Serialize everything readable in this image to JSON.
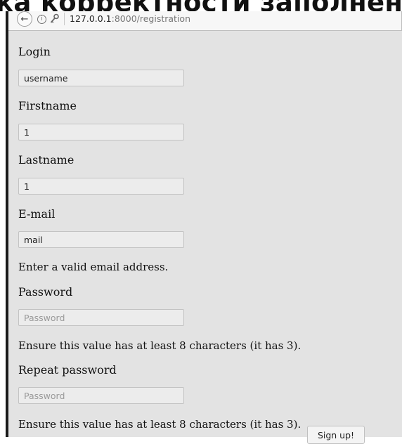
{
  "banner_text": "ка корректности заполнени",
  "browser": {
    "url_host": "127.0.0.1",
    "url_path": ":8000/registration",
    "back_icon": "arrow-left-icon",
    "info_icon": "info-icon",
    "key_icon": "key-icon"
  },
  "form": {
    "login_label": "Login",
    "login_value": "username",
    "firstname_label": "Firstname",
    "firstname_value": "1",
    "lastname_label": "Lastname",
    "lastname_value": "1",
    "email_label": "E-mail",
    "email_value": "mail",
    "email_error": "Enter a valid email address.",
    "password_label": "Password",
    "password_placeholder": "Password",
    "password_error": "Ensure this value has at least 8 characters (it has 3).",
    "repeat_label": "Repeat password",
    "repeat_placeholder": "Password",
    "repeat_error": "Ensure this value has at least 8 characters (it has 3).",
    "submit_label": "Sign up!"
  }
}
